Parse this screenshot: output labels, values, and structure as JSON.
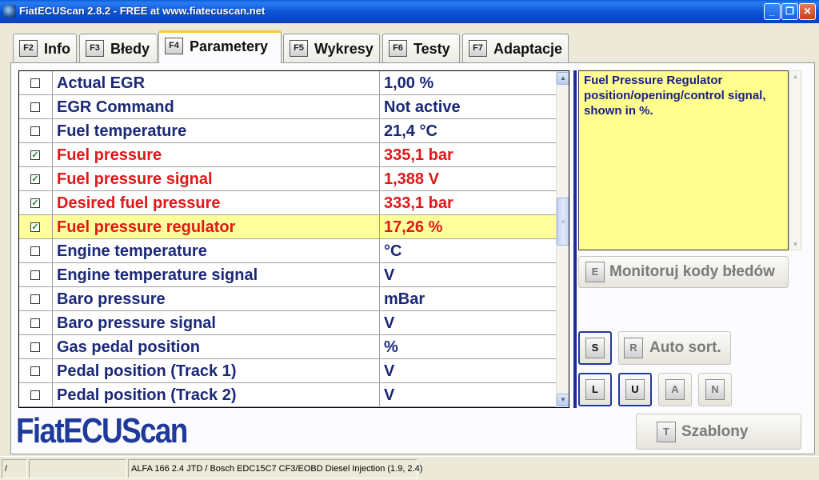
{
  "window": {
    "title": "FiatECUScan 2.8.2 - FREE at www.fiatecuscan.net",
    "controls": [
      "_",
      "❐",
      "✕"
    ]
  },
  "tabs": [
    {
      "key": "F2",
      "label": "Info",
      "active": false
    },
    {
      "key": "F3",
      "label": "Błedy",
      "active": false
    },
    {
      "key": "F4",
      "label": "Parametery",
      "active": true
    },
    {
      "key": "F5",
      "label": "Wykresy",
      "active": false
    },
    {
      "key": "F6",
      "label": "Testy",
      "active": false
    },
    {
      "key": "F7",
      "label": "Adaptacje",
      "active": false
    }
  ],
  "parameters": [
    {
      "name": "Actual EGR",
      "value": "1,00 %",
      "checked": false,
      "active": false,
      "selected": false
    },
    {
      "name": "EGR Command",
      "value": "Not active",
      "checked": false,
      "active": false,
      "selected": false
    },
    {
      "name": "Fuel temperature",
      "value": "21,4 °C",
      "checked": false,
      "active": false,
      "selected": false
    },
    {
      "name": "Fuel pressure",
      "value": "335,1 bar",
      "checked": true,
      "active": true,
      "selected": false
    },
    {
      "name": "Fuel pressure signal",
      "value": "1,388 V",
      "checked": true,
      "active": true,
      "selected": false
    },
    {
      "name": "Desired fuel pressure",
      "value": "333,1 bar",
      "checked": true,
      "active": true,
      "selected": false
    },
    {
      "name": "Fuel pressure regulator",
      "value": "17,26 %",
      "checked": true,
      "active": true,
      "selected": true
    },
    {
      "name": "Engine temperature",
      "value": " °C",
      "checked": false,
      "active": false,
      "selected": false
    },
    {
      "name": "Engine temperature signal",
      "value": " V",
      "checked": false,
      "active": false,
      "selected": false
    },
    {
      "name": "Baro pressure",
      "value": " mBar",
      "checked": false,
      "active": false,
      "selected": false
    },
    {
      "name": "Baro pressure signal",
      "value": " V",
      "checked": false,
      "active": false,
      "selected": false
    },
    {
      "name": "Gas pedal position",
      "value": " %",
      "checked": false,
      "active": false,
      "selected": false
    },
    {
      "name": "Pedal position (Track 1)",
      "value": " V",
      "checked": false,
      "active": false,
      "selected": false
    },
    {
      "name": "Pedal position (Track 2)",
      "value": " V",
      "checked": false,
      "active": false,
      "selected": false
    }
  ],
  "scroll_position": 0.43,
  "description": "Fuel Pressure Regulator position/opening/control signal, shown in %.",
  "buttons": {
    "monitor": {
      "key": "E",
      "label": "Monitoruj kody błedów"
    },
    "sort_key": "S",
    "auto_sort": {
      "key": "R",
      "label": "Auto sort."
    },
    "l_key": "L",
    "u_key": "U",
    "a_key": "A",
    "n_key": "N",
    "templates": {
      "key": "T",
      "label": "Szablony"
    }
  },
  "logo": "FiatECUScan",
  "statusbar": {
    "field1": "/",
    "field2": "",
    "vehicle": "ALFA 166 2.4 JTD / Bosch EDC15C7 CF3/EOBD Diesel Injection (1.9, 2.4)"
  }
}
